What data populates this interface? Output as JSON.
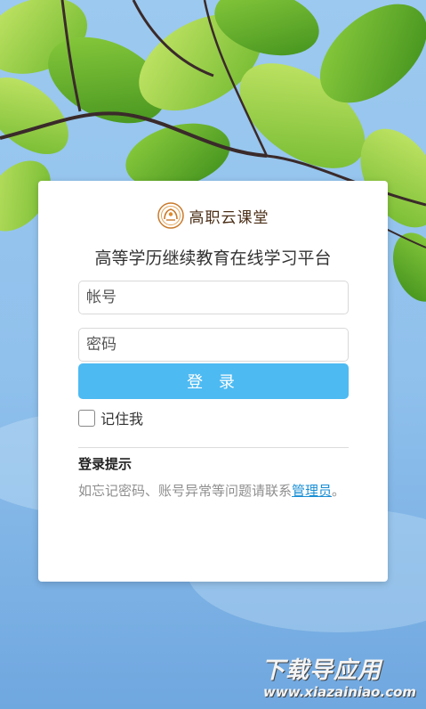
{
  "brand": {
    "name": "高职云课堂",
    "logo_icon": "laurel-seal-logo-icon",
    "color": "#4a2e16"
  },
  "platform_title": "高等学历继续教育在线学习平台",
  "form": {
    "account_placeholder": "帐号",
    "password_placeholder": "密码",
    "login_label": "登 录",
    "remember_label": "记住我",
    "remember_checked": false
  },
  "hint": {
    "title": "登录提示",
    "text_before": "如忘记密码、账号异常等问题请联系",
    "link": "管理员",
    "text_after": "。"
  },
  "watermark": {
    "title": "下载导应用",
    "url": "www.xiazainiao.com"
  },
  "colors": {
    "accent": "#4dbaf2",
    "link": "#1a8fd4",
    "sky": "#7fb6e6"
  }
}
